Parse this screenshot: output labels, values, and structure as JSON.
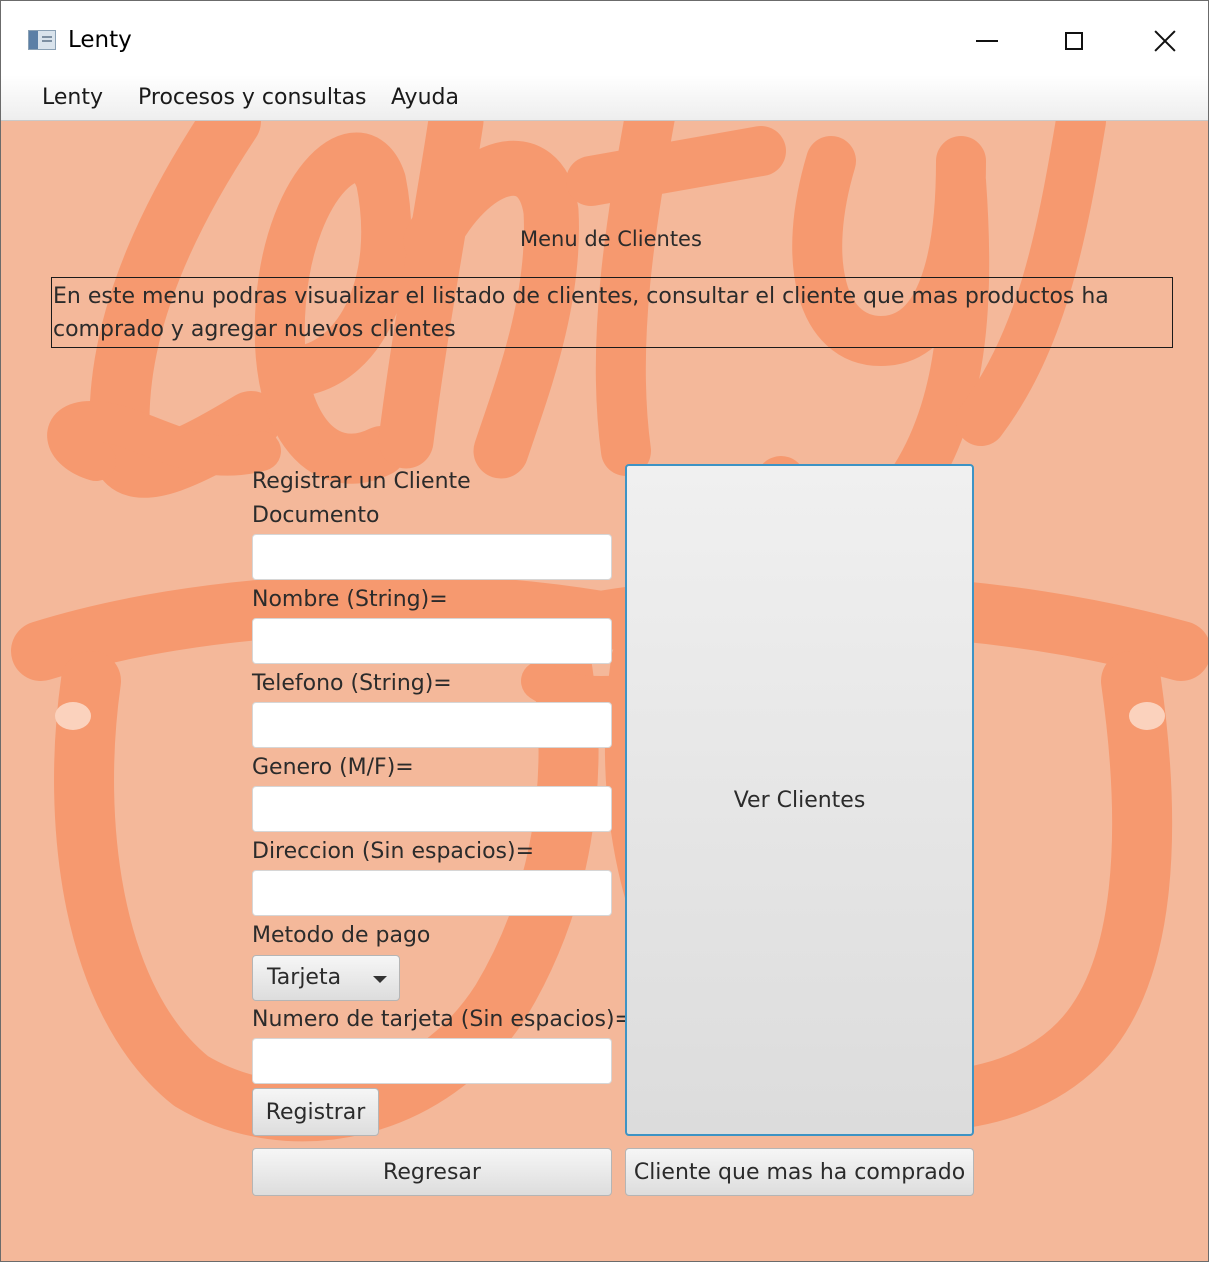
{
  "window": {
    "title": "Lenty"
  },
  "menubar": {
    "items": [
      "Lenty",
      "Procesos y consultas",
      "Ayuda"
    ]
  },
  "main": {
    "heading": "Menu de Clientes",
    "description": "En este menu podras visualizar el listado de clientes, consultar el cliente que mas productos ha comprado y agregar nuevos clientes",
    "form": {
      "title": "Registrar un Cliente",
      "documento_label": "Documento",
      "documento_value": "",
      "nombre_label": "Nombre (String)=",
      "nombre_value": "",
      "telefono_label": "Telefono (String)=",
      "telefono_value": "",
      "genero_label": "Genero (M/F)=",
      "genero_value": "",
      "direccion_label": "Direccion (Sin espacios)=",
      "direccion_value": "",
      "metodo_label": "Metodo de pago",
      "metodo_selected": "Tarjeta",
      "tarjeta_label": "Numero de tarjeta (Sin espacios)=",
      "tarjeta_value": "",
      "registrar_label": "Registrar"
    },
    "ver_clientes_label": "Ver Clientes",
    "regresar_label": "Regresar",
    "top_client_label": "Cliente que mas ha comprado"
  },
  "colors": {
    "background": "#f4b89a",
    "watermark": "#f6996f",
    "focus_border": "#3d93c4"
  },
  "icons": {
    "app": "app-window-icon",
    "minimize": "minimize-icon",
    "maximize": "maximize-icon",
    "close": "close-icon",
    "dropdown": "chevron-down-icon"
  }
}
